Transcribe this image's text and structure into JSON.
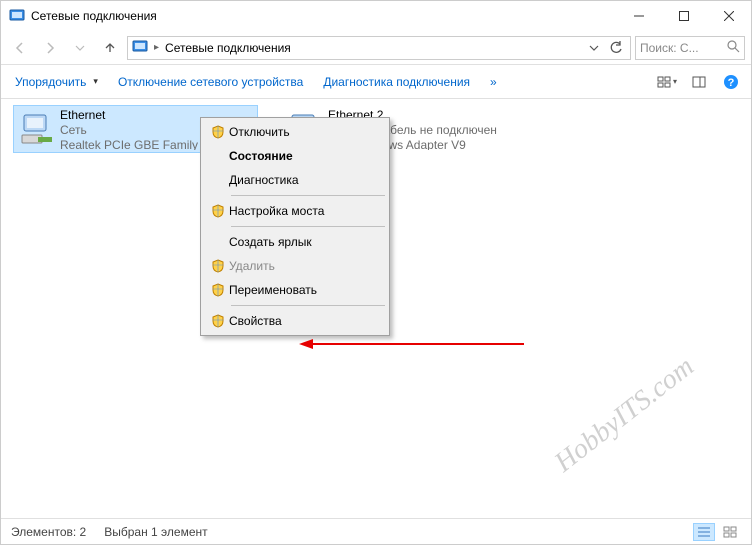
{
  "window": {
    "title": "Сетевые подключения"
  },
  "breadcrumb": {
    "location": "Сетевые подключения"
  },
  "search": {
    "placeholder": "Поиск: С..."
  },
  "toolbar": {
    "organize": "Упорядочить",
    "disable": "Отключение сетевого устройства",
    "diagnose": "Диагностика подключения",
    "more": "»"
  },
  "adapters": [
    {
      "name": "Ethernet",
      "status": "Сеть",
      "device": "Realtek PCIe GBE Family",
      "selected": true
    },
    {
      "name": "Ethernet 2",
      "status": "Сетевой кабель не подключен",
      "device": "TAP-Windows Adapter V9",
      "selected": false
    }
  ],
  "context_menu": {
    "items": [
      {
        "label": "Отключить",
        "shield": true
      },
      {
        "label": "Состояние",
        "bold": true
      },
      {
        "label": "Диагностика"
      },
      {
        "sep": true
      },
      {
        "label": "Настройка моста",
        "shield": true
      },
      {
        "sep": true
      },
      {
        "label": "Создать ярлык"
      },
      {
        "label": "Удалить",
        "shield": true,
        "disabled": true
      },
      {
        "label": "Переименовать",
        "shield": true
      },
      {
        "sep": true
      },
      {
        "label": "Свойства",
        "shield": true
      }
    ]
  },
  "statusbar": {
    "elements_label": "Элементов:",
    "elements_count": "2",
    "selected_label": "Выбран 1 элемент"
  },
  "watermark": "HobbyITS.com"
}
